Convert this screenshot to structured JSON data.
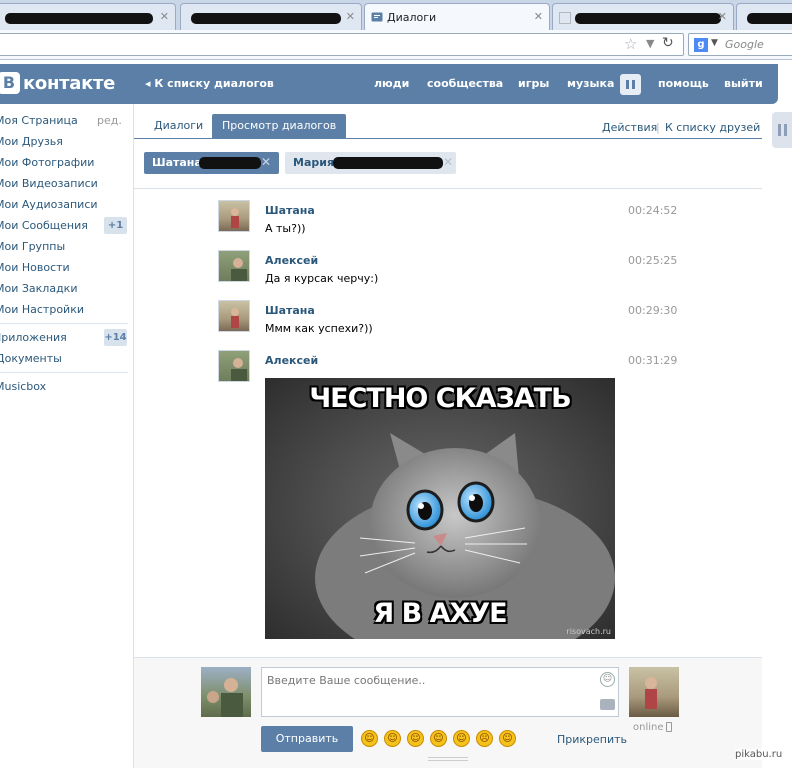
{
  "browser": {
    "active_tab_title": "Диалоги",
    "search_placeholder": "Google"
  },
  "header": {
    "logo_letter": "В",
    "logo_text": "контакте",
    "back_link": "К списку диалогов",
    "nav": [
      "люди",
      "сообщества",
      "игры",
      "музыка",
      "помощь",
      "выйти"
    ]
  },
  "sidebar": {
    "edit_label": "ред.",
    "items": [
      {
        "label": "Моя Страница"
      },
      {
        "label": "Мои Друзья"
      },
      {
        "label": "Мои Фотографии"
      },
      {
        "label": "Мои Видеозаписи"
      },
      {
        "label": "Мои Аудиозаписи"
      },
      {
        "label": "Мои Сообщения",
        "badge": "+1"
      },
      {
        "label": "Мои Группы"
      },
      {
        "label": "Мои Новости"
      },
      {
        "label": "Мои Закладки"
      },
      {
        "label": "Мои Настройки"
      },
      {
        "label": "Приложения",
        "badge": "+14"
      },
      {
        "label": "Документы"
      },
      {
        "label": "Musicbox"
      }
    ]
  },
  "tabs": {
    "dialogs": "Диалоги",
    "view_dialogs": "Просмотр диалогов",
    "actions": "Действия",
    "separator": "|",
    "to_friends": "К списку друзей"
  },
  "participants": [
    "Шатана",
    "Мария"
  ],
  "messages": [
    {
      "author": "Шатана",
      "text": "А ты?))",
      "time": "00:24:52"
    },
    {
      "author": "Алексей",
      "text": "Да я курсак черчу:)",
      "time": "00:25:25"
    },
    {
      "author": "Шатана",
      "text": "Ммм как успехи?))",
      "time": "00:29:30"
    },
    {
      "author": "Алексей",
      "text": "",
      "time": "00:31:29"
    }
  ],
  "meme": {
    "top_text": "ЧЕСТНО СКАЗАТЬ",
    "bottom_text": "Я В АХУЕ",
    "watermark": "risovach.ru"
  },
  "compose": {
    "placeholder": "Введите Ваше сообщение..",
    "send_label": "Отправить",
    "attach_label": "Прикрепить",
    "status": "online"
  },
  "watermark": "pikabu.ru"
}
